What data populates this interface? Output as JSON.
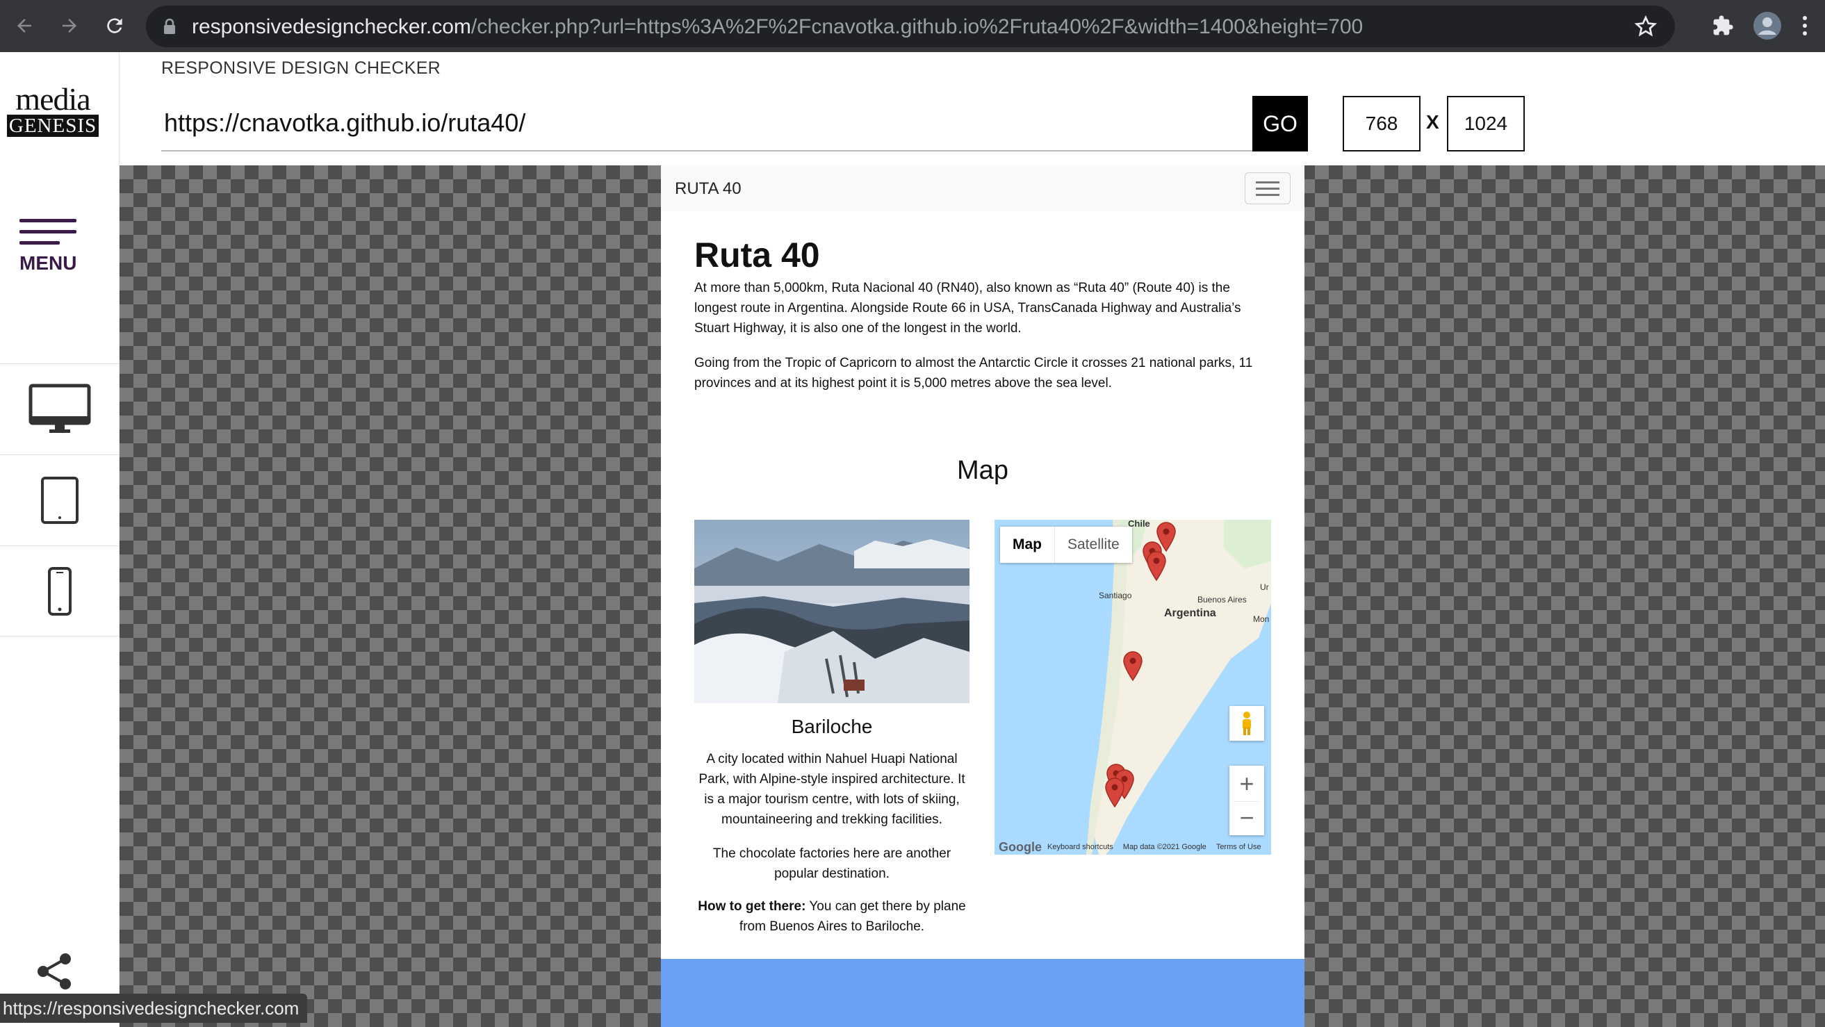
{
  "browser": {
    "url_host": "responsivedesignchecker.com",
    "url_rest": "/checker.php?url=https%3A%2F%2Fcnavotka.github.io%2Fruta40%2F&width=1400&height=700",
    "status_url": "https://responsivedesignchecker.com"
  },
  "sidebar": {
    "logo_top": "media",
    "logo_bottom": "GENESIS",
    "menu_label": "MENU"
  },
  "tool": {
    "title": "RESPONSIVE DESIGN CHECKER",
    "url_value": "https://cnavotka.github.io/ruta40/",
    "go_label": "GO",
    "width_value": "768",
    "x_separator": "X",
    "height_value": "1024"
  },
  "site": {
    "brand": "RUTA 40",
    "heading": "Ruta 40",
    "intro_1": "At more than 5,000km, Ruta Nacional 40 (RN40), also known as “Ruta 40” (Route 40) is the longest route in Argentina. Alongside Route 66 in USA, TransCanada Highway and Australia’s Stuart Highway, it is also one of the longest in the world.",
    "intro_2": "Going from the Tropic of Capricorn to almost the Antarctic Circle it crosses 21 national parks, 11 provinces and at its highest point it is 5,000 metres above the sea level.",
    "map_heading": "Map",
    "card": {
      "title": "Bariloche",
      "p1": "A city located within Nahuel Huapi National Park, with Alpine-style inspired architecture. It is a major tourism centre, with lots of skiing, mountaineering and trekking facilities.",
      "p2": "The chocolate factories here are another popular destination.",
      "how_label": "How to get there:",
      "how_text": " You can get there by plane from Buenos Aires to Bariloche."
    },
    "map": {
      "tab_map": "Map",
      "tab_satellite": "Satellite",
      "labels": {
        "chile": "Chile",
        "santiago": "Santiago",
        "buenos_aires": "Buenos Aires",
        "argentina": "Argentina",
        "uruguay": "Ur",
        "montevideo": "Mon"
      },
      "attr_logo": "Google",
      "attr_shortcuts": "Keyboard shortcuts",
      "attr_data": "Map data ©2021 Google",
      "attr_terms": "Terms of Use",
      "zoom_in": "+",
      "zoom_out": "−"
    }
  },
  "colors": {
    "menu_purple": "#3a1a49",
    "footer_blue": "#6ca0f5",
    "pin_red": "#d6453b"
  }
}
